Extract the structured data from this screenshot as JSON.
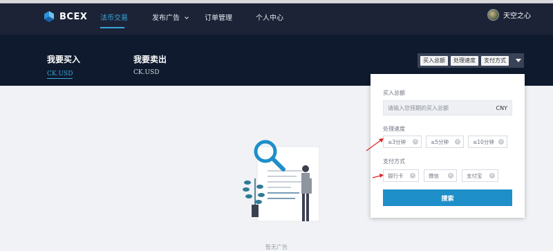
{
  "nav": {
    "brand": "BCEX",
    "items": [
      {
        "label": "法币交易"
      },
      {
        "label": "发布广告"
      },
      {
        "label": "订单管理"
      },
      {
        "label": "个人中心"
      }
    ],
    "user_name": "天空之心"
  },
  "trade": {
    "buy_title": "我要买入",
    "buy_currency": "CK.USD",
    "sell_title": "我要卖出",
    "sell_currency": "CK.USD"
  },
  "filters": {
    "tags": [
      "买入总额",
      "处理速度",
      "支付方式"
    ]
  },
  "panel": {
    "amount_label": "买入总额",
    "amount_placeholder": "请输入您预期的买入总额",
    "amount_currency": "CNY",
    "speed_label": "处理速度",
    "speed_options": [
      "≤3分钟",
      "≤5分钟",
      "≤10分钟"
    ],
    "payment_label": "支付方式",
    "payment_options": [
      "银行卡",
      "微信",
      "支付宝"
    ],
    "search_label": "搜索"
  },
  "empty": {
    "text": "暂无广告"
  },
  "colors": {
    "nav_bg": "#1c2337",
    "header_bg": "#0f1a2e",
    "accent": "#3aa7dc",
    "button": "#1f8fc9",
    "annotation_arrow": "#e02020"
  }
}
